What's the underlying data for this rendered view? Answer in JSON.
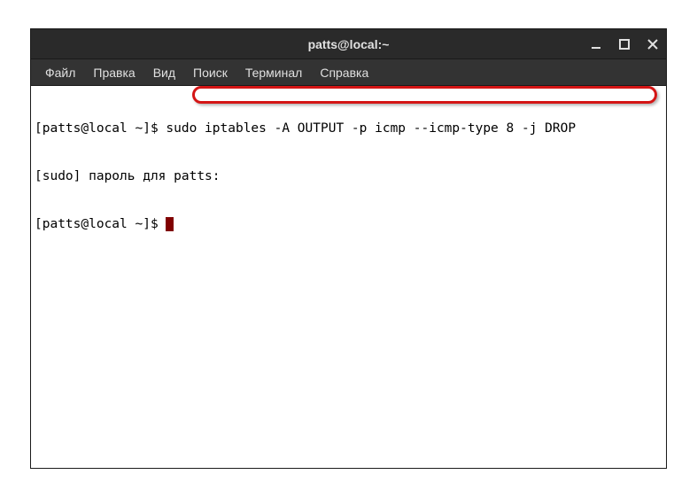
{
  "window": {
    "title": "patts@local:~"
  },
  "menubar": {
    "items": [
      {
        "label": "Файл"
      },
      {
        "label": "Правка"
      },
      {
        "label": "Вид"
      },
      {
        "label": "Поиск"
      },
      {
        "label": "Терминал"
      },
      {
        "label": "Справка"
      }
    ]
  },
  "terminal": {
    "lines": [
      {
        "prompt": "[patts@local ~]$ ",
        "content": "sudo iptables -A OUTPUT -p icmp --icmp-type 8 -j DROP",
        "highlighted": true
      },
      {
        "prompt": "",
        "content": "[sudo] пароль для patts:",
        "highlighted": false
      },
      {
        "prompt": "[patts@local ~]$ ",
        "content": "",
        "highlighted": false,
        "cursor": true
      }
    ]
  }
}
